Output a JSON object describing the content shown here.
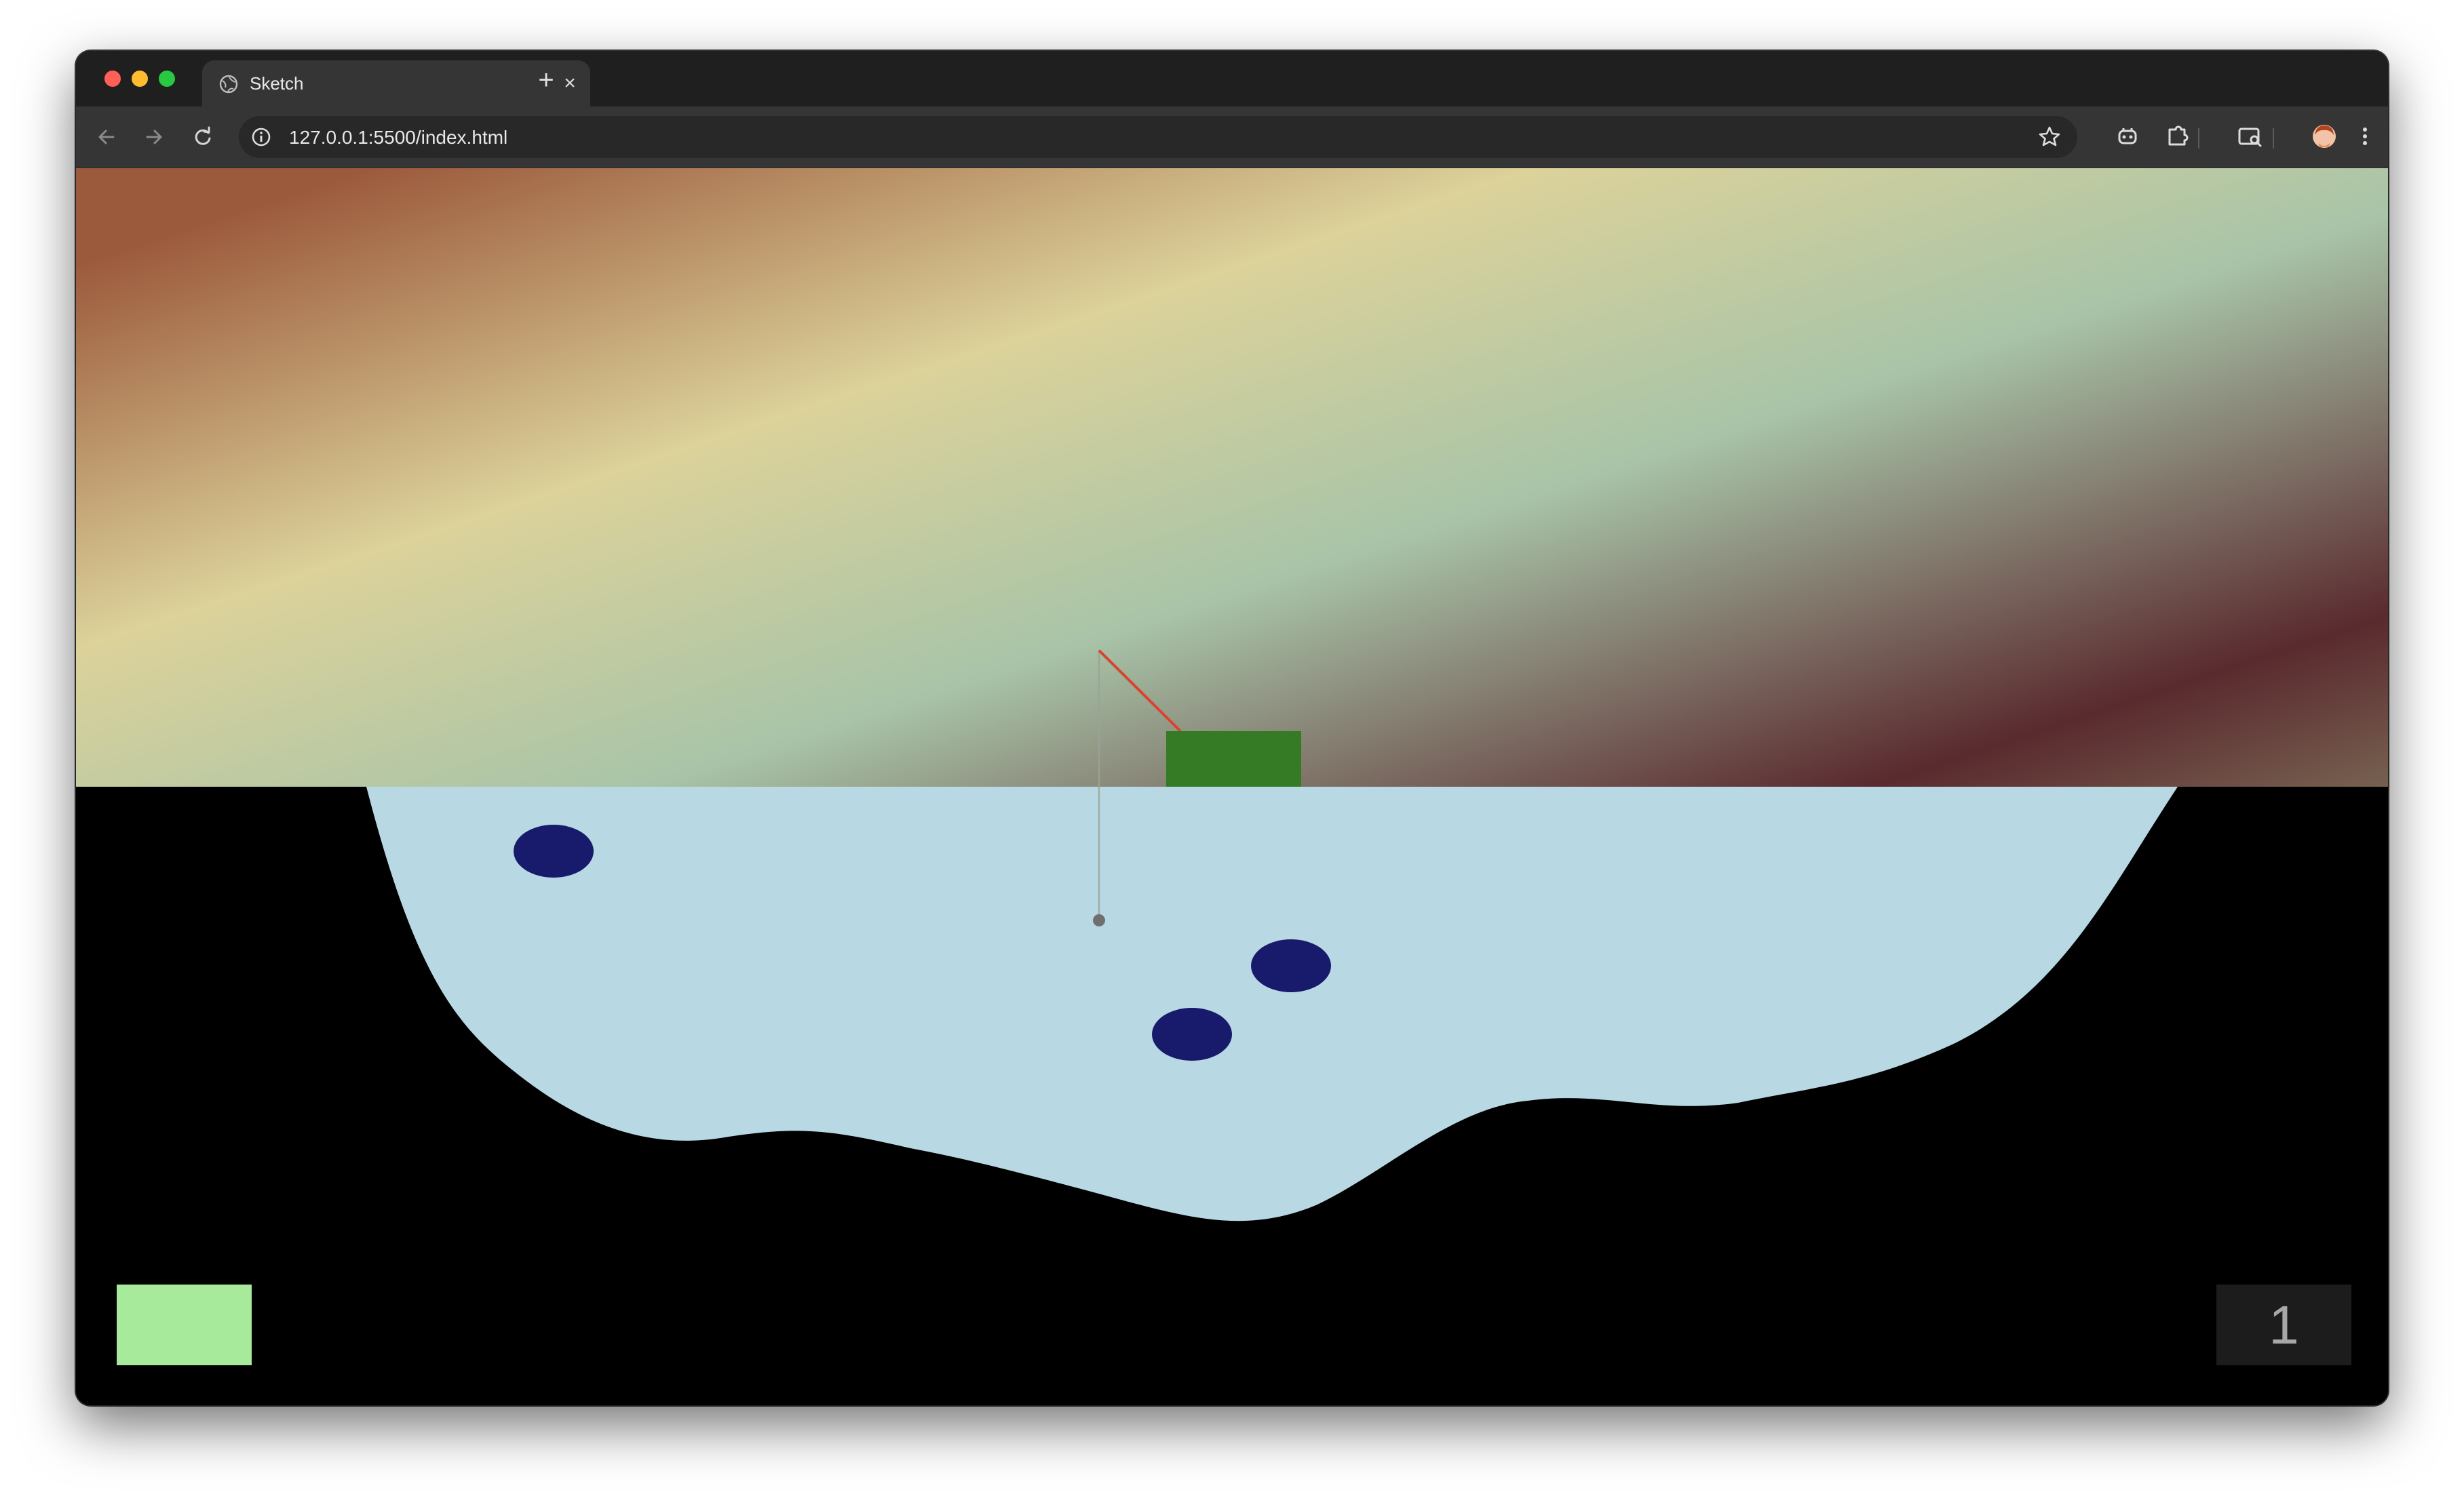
{
  "browser": {
    "tab_title": "Sketch",
    "tab_close": "×",
    "new_tab": "+",
    "url": "127.0.0.1:5500/index.html",
    "icons": [
      "back-icon",
      "forward-icon",
      "reload-icon",
      "site-info-icon",
      "bookmark-star-icon",
      "extension-puzzle-icon",
      "extensions-icon",
      "tab-search-icon",
      "profile-avatar-icon",
      "more-menu-icon"
    ]
  },
  "game": {
    "score": "1",
    "colors": {
      "sky": [
        "#9c5a3c",
        "#dcd29a",
        "#a8c4a8",
        "#5a2a2e",
        "#8e8c6c"
      ],
      "water": "#b8d9e4",
      "terrain": "#000000",
      "boat": "#357a25",
      "rod": "#d9432e",
      "line": "#9aa39a",
      "hook": "#6f6f6f",
      "fish": "#181b6b",
      "swatch": "#a8ea9c",
      "score_bg": "#1c1c1c",
      "score_text": "#a8a8a8"
    },
    "fish_count": 3
  }
}
